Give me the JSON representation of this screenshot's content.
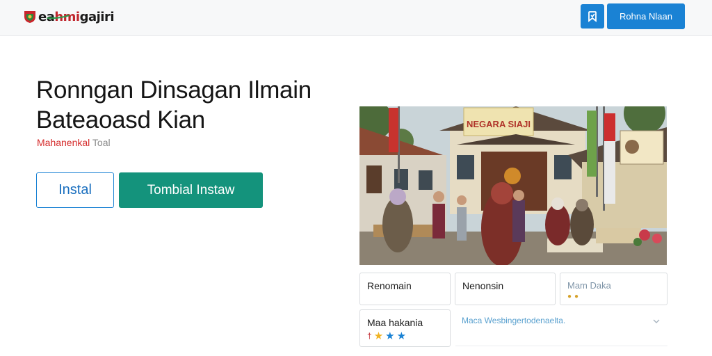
{
  "header": {
    "logo": {
      "text_start": "ea",
      "text_accent": "hmi",
      "text_end": "gajiri",
      "icon": "shield-logo-icon"
    },
    "icon_button": {
      "icon": "bookmark-icon"
    },
    "primary_button": "Rohna Nlaan"
  },
  "hero": {
    "title_line1": "Ronngan Dinsagan Ilmain",
    "title_line2": "Bateaoasd Kian",
    "subtitle_red": "Mahanenkal",
    "subtitle_grey": " Toal",
    "buttons": {
      "install": "Instal",
      "cta": "Tombial Instaw"
    }
  },
  "photo": {
    "banner_text": "NEGARA SIAJI",
    "description_icon": "community-event-photo"
  },
  "cards": [
    {
      "title": "Renomain"
    },
    {
      "title": "Nenonsin"
    },
    {
      "title": "Mam  Daka",
      "icons": [
        "●",
        "●"
      ]
    },
    {
      "title": "Maa hakania",
      "rating": [
        "†",
        "★",
        "★",
        "★"
      ]
    }
  ],
  "select": {
    "value": "Maca Wesbingertodenaelta.",
    "icon": "chevron-down-icon"
  },
  "colors": {
    "primary_blue": "#1a82d4",
    "teal": "#14937c",
    "accent_red": "#c0262d"
  }
}
